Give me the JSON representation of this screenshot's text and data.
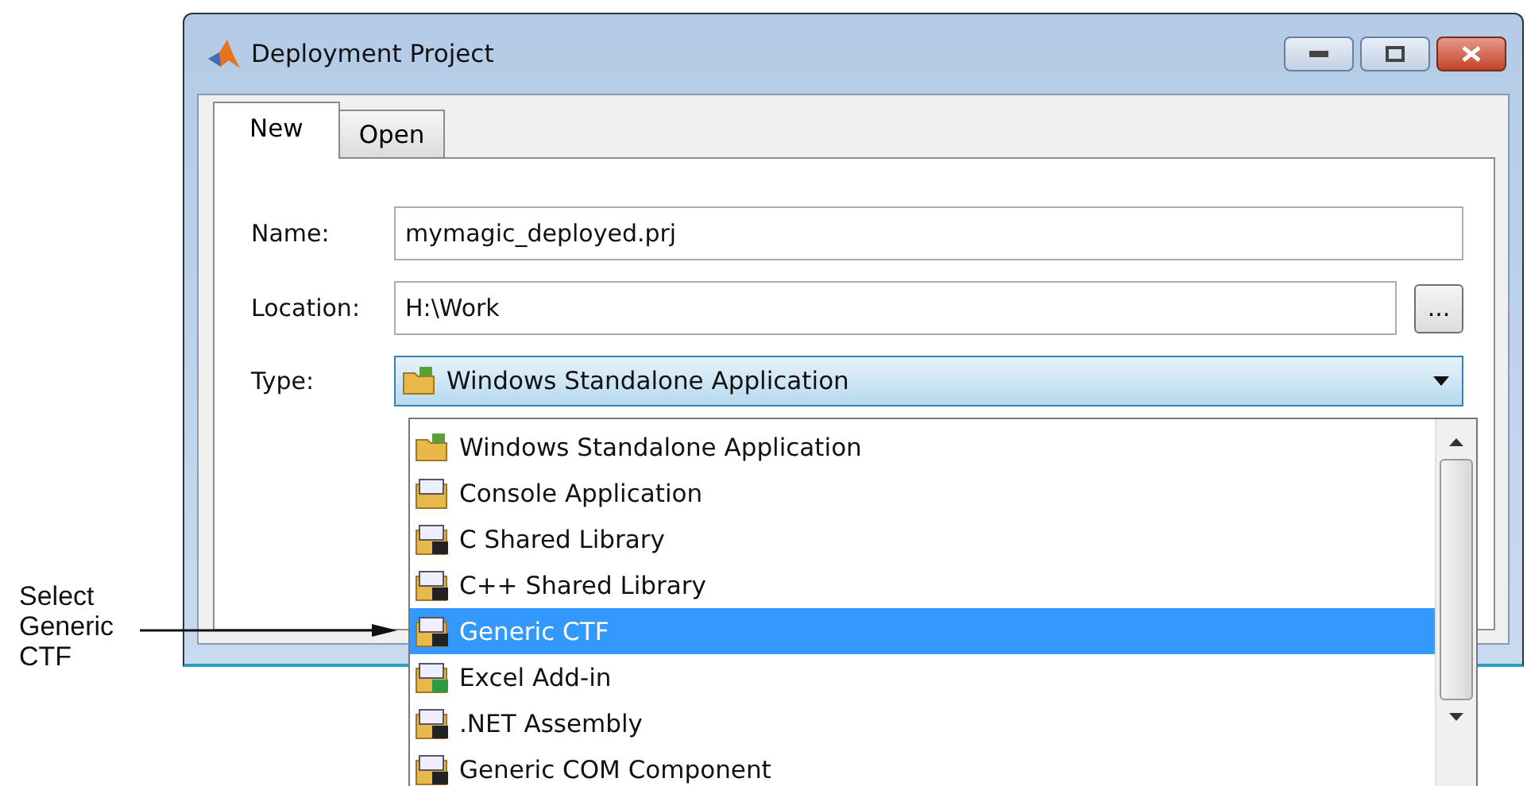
{
  "window": {
    "title": "Deployment Project"
  },
  "tabs": [
    {
      "label": "New",
      "selected": true
    },
    {
      "label": "Open",
      "selected": false
    }
  ],
  "form": {
    "name_label": "Name:",
    "name_value": "mymagic_deployed.prj",
    "location_label": "Location:",
    "location_value": "H:\\Work",
    "browse_button": "...",
    "type_label": "Type:",
    "type_value": "Windows Standalone Application",
    "type_expanded": true
  },
  "type_options": [
    {
      "label": "Windows Standalone Application",
      "selected": false
    },
    {
      "label": "Console Application",
      "selected": false
    },
    {
      "label": "C Shared Library",
      "selected": false
    },
    {
      "label": "C++ Shared Library",
      "selected": false
    },
    {
      "label": "Generic CTF",
      "selected": true
    },
    {
      "label": "Excel Add-in",
      "selected": false
    },
    {
      "label": ".NET Assembly",
      "selected": false
    },
    {
      "label": "Generic COM Component",
      "selected": false
    }
  ],
  "callout": {
    "text": "Select Generic CTF"
  }
}
